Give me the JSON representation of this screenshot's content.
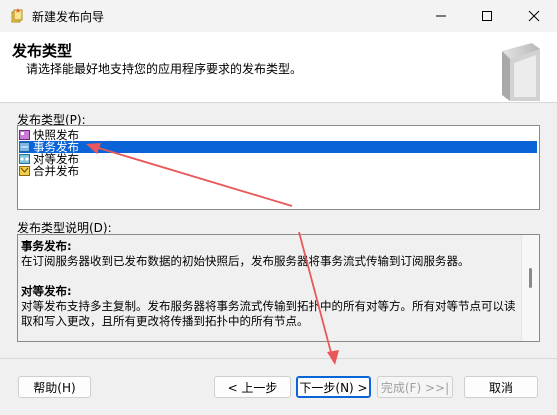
{
  "window": {
    "title": "新建发布向导"
  },
  "header": {
    "title": "发布类型",
    "subtitle": "请选择能最好地支持您的应用程序要求的发布类型。"
  },
  "publication_type_label": "发布类型(P):",
  "publication_types": [
    {
      "label": "快照发布",
      "icon": "snapshot-publication-icon",
      "selected": false
    },
    {
      "label": "事务发布",
      "icon": "transactional-publication-icon",
      "selected": true
    },
    {
      "label": "对等发布",
      "icon": "peer-to-peer-publication-icon",
      "selected": false
    },
    {
      "label": "合并发布",
      "icon": "merge-publication-icon",
      "selected": false
    }
  ],
  "description_label": "发布类型说明(D):",
  "description": {
    "p1_title": "事务发布:",
    "p1_body": "在订阅服务器收到已发布数据的初始快照后，发布服务器将事务流式传输到订阅服务器。",
    "p2_title": "对等发布:",
    "p2_body": "对等发布支持多主复制。发布服务器将事务流式传输到拓扑中的所有对等方。所有对等节点可以读取和写入更改，且所有更改将传播到拓扑中的所有节点。"
  },
  "buttons": {
    "help": "帮助(H)",
    "back": "< 上一步",
    "next": "下一步(N) >",
    "finish": "完成(F) >>|",
    "cancel": "取消"
  },
  "colors": {
    "selection": "#0a64d8",
    "annotation_arrow": "#e8585a"
  }
}
